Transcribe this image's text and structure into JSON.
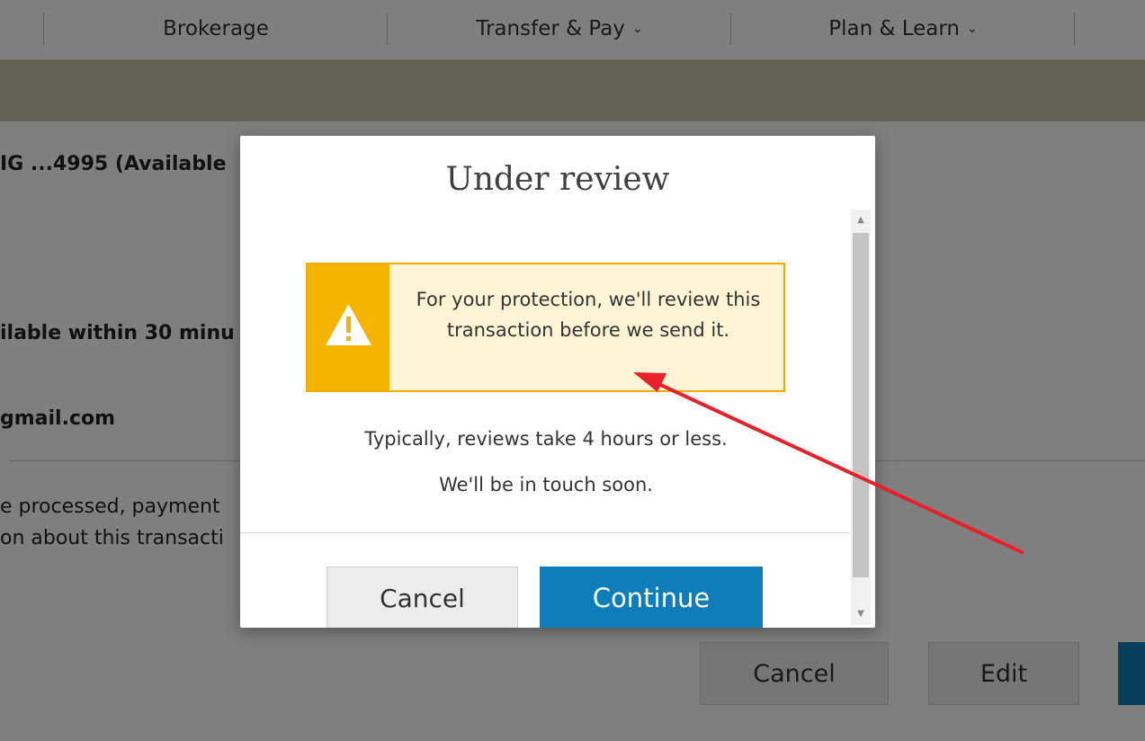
{
  "nav": {
    "items": [
      {
        "label": "Brokerage",
        "chevron": false
      },
      {
        "label": "Transfer & Pay",
        "chevron": true
      },
      {
        "label": "Plan & Learn",
        "chevron": true
      }
    ]
  },
  "background": {
    "account_line": "IG ...4995 (Available",
    "availability_line": "ilable within 30 minu",
    "email_line": "gmail.com",
    "note_line_1": "e processed, payment",
    "note_line_2": "on about this transacti",
    "cancel_label": "Cancel",
    "edit_label": "Edit"
  },
  "modal": {
    "title": "Under review",
    "alert": {
      "icon": "warning-triangle-icon",
      "text": "For your protection, we'll review this transaction before we send it."
    },
    "body_line_1": "Typically, reviews take 4 hours or less.",
    "body_line_2": "We'll be in touch soon.",
    "cancel_label": "Cancel",
    "continue_label": "Continue"
  },
  "colors": {
    "primary_button": "#0f7dba",
    "alert_accent": "#f5b400",
    "alert_background": "#fff4d6",
    "annotation_arrow": "#e8202a"
  }
}
